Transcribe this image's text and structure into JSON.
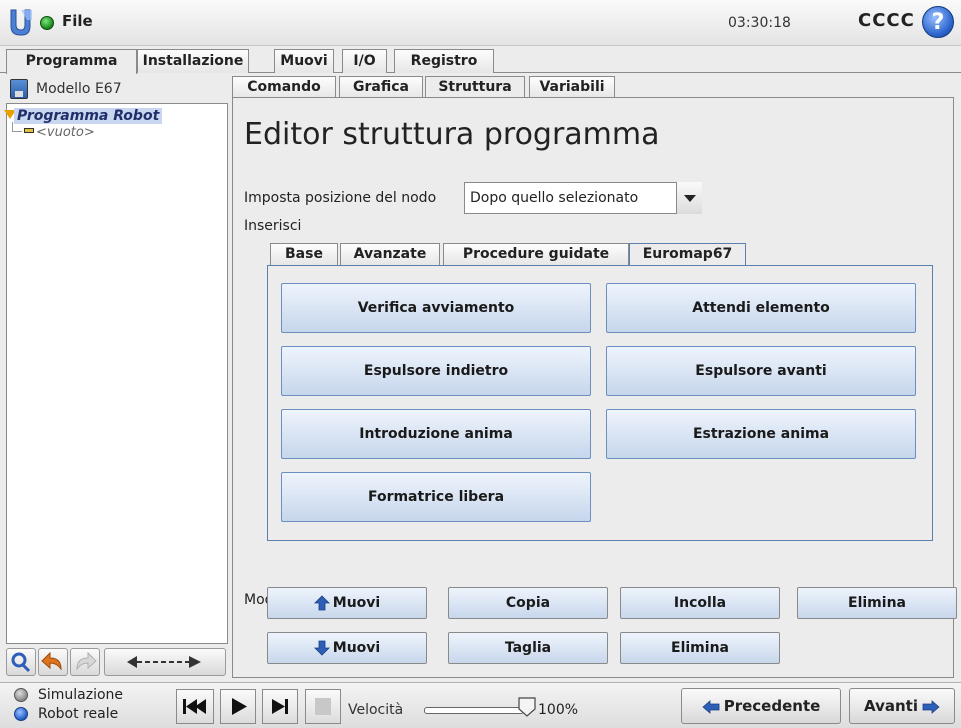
{
  "header": {
    "file_label": "File",
    "clock": "03:30:18",
    "robot_name": "CCCC",
    "help_symbol": "?"
  },
  "main_tabs": [
    {
      "label": "Programma",
      "active": true
    },
    {
      "label": "Installazione",
      "active": false
    },
    {
      "label": "Muovi",
      "active": false
    },
    {
      "label": "I/O",
      "active": false
    },
    {
      "label": "Registro",
      "active": false
    }
  ],
  "left_panel": {
    "file_name": "Modello E67",
    "tree_root": "Programma Robot",
    "tree_child": "<vuoto>"
  },
  "sub_tabs": [
    {
      "label": "Comando",
      "active": false
    },
    {
      "label": "Grafica",
      "active": false
    },
    {
      "label": "Struttura",
      "active": true
    },
    {
      "label": "Variabili",
      "active": false
    }
  ],
  "editor": {
    "title": "Editor struttura programma",
    "position_label": "Imposta posizione del nodo",
    "position_value": "Dopo quello selezionato",
    "insert_label": "Inserisci",
    "insert_tabs": [
      {
        "label": "Base",
        "active": false
      },
      {
        "label": "Avanzate",
        "active": false
      },
      {
        "label": "Procedure guidate",
        "active": false
      },
      {
        "label": "Euromap67",
        "active": true
      }
    ],
    "insert_buttons": [
      "Verifica avviamento",
      "Attendi elemento",
      "Espulsore indietro",
      "Espulsore avanti",
      "Introduzione anima",
      "Estrazione anima",
      "Formatrice libera"
    ],
    "modify_label": "Modifica",
    "modify_buttons": {
      "move_up": "Muovi",
      "copy": "Copia",
      "paste": "Incolla",
      "delete_top": "Elimina",
      "move_down": "Muovi",
      "cut": "Taglia",
      "delete": "Elimina"
    }
  },
  "footer": {
    "simulation": "Simulazione",
    "real_robot": "Robot reale",
    "speed_label": "Velocità",
    "speed_value": "100%",
    "previous": "Precedente",
    "next": "Avanti"
  },
  "colors": {
    "accent_blue": "#2d5fb8",
    "button_top": "#eef4fc",
    "button_bottom": "#c6d6ec",
    "folder_orange": "#e8a200"
  }
}
